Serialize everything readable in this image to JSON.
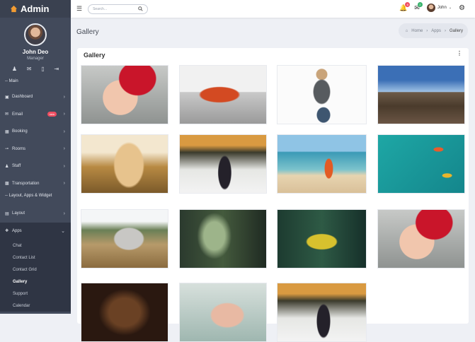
{
  "brand": "Admin",
  "profile": {
    "name": "John Deo",
    "role": "Manager"
  },
  "menu": {
    "header_main": "-- Main",
    "items": [
      {
        "label": "Dashboard",
        "icon": "dashboard-icon"
      },
      {
        "label": "Email",
        "icon": "email-icon",
        "badge": "new"
      },
      {
        "label": "Booking",
        "icon": "booking-icon"
      },
      {
        "label": "Rooms",
        "icon": "key-icon"
      },
      {
        "label": "Staff",
        "icon": "staff-icon"
      },
      {
        "label": "Transportation",
        "icon": "car-icon"
      }
    ],
    "header_layout": "-- Layout, Apps & Widget",
    "layout": "Layout",
    "apps": "Apps",
    "apps_sub": [
      "Chat",
      "Contact List",
      "Contact Grid",
      "Gallery",
      "Support",
      "Calendar"
    ]
  },
  "search": {
    "placeholder": "Search..."
  },
  "topbar": {
    "user": "John",
    "notif_count": "6",
    "mail_count": "2"
  },
  "page": {
    "title": "Gallery",
    "breadcrumb": [
      "Home",
      "Apps",
      "Gallery"
    ]
  },
  "card": {
    "title": "Gallery"
  },
  "photos": [
    "baby in santa hat",
    "toy bus",
    "woman in t-shirt",
    "bridge city",
    "woman in field",
    "woman in snow",
    "couple on beach",
    "boats aerial",
    "bull in field",
    "plants",
    "yellow umbrella",
    "baby in santa hat",
    "curly hair woman",
    "baby in bath",
    "woman in snow"
  ]
}
